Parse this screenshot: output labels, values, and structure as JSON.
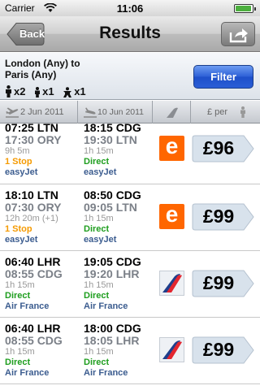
{
  "status": {
    "carrier": "Carrier",
    "time": "11:06"
  },
  "nav": {
    "back_label": "Back",
    "title": "Results"
  },
  "search": {
    "route_line1": "London (Any) to",
    "route_line2": "Paris (Any)",
    "adults": "x2",
    "children": "x1",
    "infants": "x1",
    "filter_label": "Filter"
  },
  "sort": {
    "depart": "2 Jun 2011",
    "return": "10 Jun 2011",
    "price_per": "£ per"
  },
  "results": [
    {
      "out": {
        "dep": "07:25 LTN",
        "arr": "17:30 ORY",
        "duration": "9h 5m",
        "stops": "1 Stop",
        "airline": "easyJet"
      },
      "ret": {
        "dep": "18:15 CDG",
        "arr": "19:30 LTN",
        "duration": "1h 15m",
        "stops": "Direct",
        "airline": "easyJet"
      },
      "logo": "easyjet-logo",
      "price": "£96"
    },
    {
      "out": {
        "dep": "18:10 LTN",
        "arr": "07:30 ORY",
        "duration": "12h 20m (+1)",
        "stops": "1 Stop",
        "airline": "easyJet"
      },
      "ret": {
        "dep": "08:50 CDG",
        "arr": "09:05 LTN",
        "duration": "1h 15m",
        "stops": "Direct",
        "airline": "easyJet"
      },
      "logo": "easyjet-logo",
      "price": "£99"
    },
    {
      "out": {
        "dep": "06:40 LHR",
        "arr": "08:55 CDG",
        "duration": "1h 15m",
        "stops": "Direct",
        "airline": "Air France"
      },
      "ret": {
        "dep": "19:05 CDG",
        "arr": "19:20 LHR",
        "duration": "1h 15m",
        "stops": "Direct",
        "airline": "Air France"
      },
      "logo": "air-france-logo",
      "price": "£99"
    },
    {
      "out": {
        "dep": "06:40 LHR",
        "arr": "08:55 CDG",
        "duration": "1h 15m",
        "stops": "Direct",
        "airline": "Air France"
      },
      "ret": {
        "dep": "18:00 CDG",
        "arr": "18:05 LHR",
        "duration": "1h 15m",
        "stops": "Direct",
        "airline": "Air France"
      },
      "logo": "air-france-logo",
      "price": "£99"
    }
  ],
  "colors": {
    "stop_orange": "#f59a00",
    "direct_green": "#1f9e1f",
    "airline_blue": "#3b5c8f",
    "filter_blue": "#2c5fd6",
    "easyjet_orange": "#ff6600"
  }
}
